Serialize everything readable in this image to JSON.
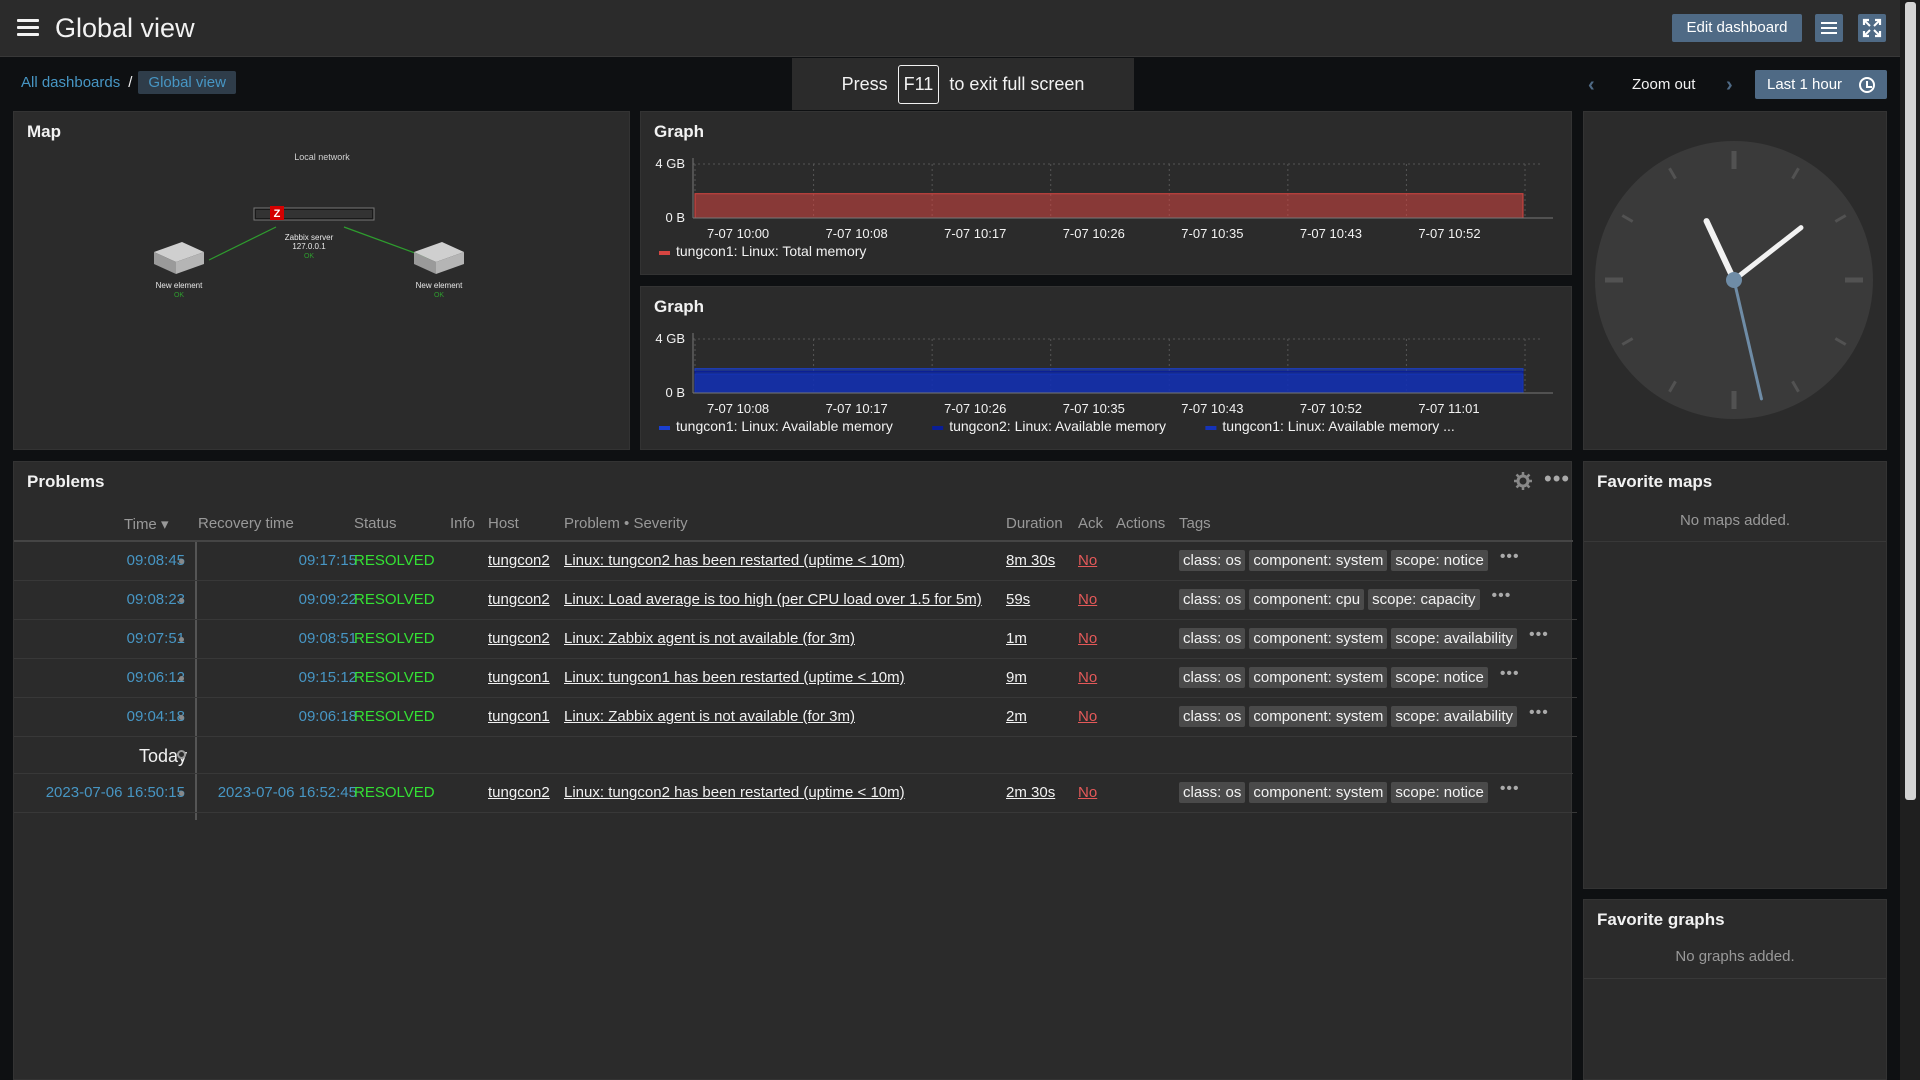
{
  "header": {
    "title": "Global view",
    "edit_label": "Edit dashboard"
  },
  "breadcrumb": {
    "all": "All dashboards",
    "separator": "/",
    "current": "Global view"
  },
  "fullscreen_banner": {
    "press": "Press",
    "key": "F11",
    "suffix": "to exit full screen"
  },
  "timebar": {
    "zoom_out": "Zoom out",
    "period": "Last 1 hour"
  },
  "map": {
    "title": "Map",
    "map_name": "Local network",
    "server_label": "Zabbix server",
    "server_ip": "127.0.0.1",
    "server_status": "OK",
    "left_label": "New element",
    "left_status": "OK",
    "right_label": "New element",
    "right_status": "OK"
  },
  "graph1": {
    "title": "Graph",
    "chart_data": {
      "type": "area",
      "y_ticks": [
        "4 GB",
        "0 B"
      ],
      "x_ticks": [
        "7-07 10:00",
        "7-07 10:08",
        "7-07 10:17",
        "7-07 10:26",
        "7-07 10:35",
        "7-07 10:43",
        "7-07 10:52"
      ],
      "series": [
        {
          "name": "tungcon1: Linux: Total memory",
          "color": "#d64541",
          "level": 0.45
        }
      ]
    }
  },
  "graph2": {
    "title": "Graph",
    "chart_data": {
      "type": "area",
      "y_ticks": [
        "4 GB",
        "0 B"
      ],
      "x_ticks": [
        "7-07 10:08",
        "7-07 10:17",
        "7-07 10:26",
        "7-07 10:35",
        "7-07 10:43",
        "7-07 10:52",
        "7-07 11:01"
      ],
      "series": [
        {
          "name": "tungcon1: Linux: Available memory",
          "color": "#1a3fd0",
          "level": 0.45
        },
        {
          "name": "tungcon2: Linux: Available memory",
          "color": "#0a1e96",
          "level": 0.4
        },
        {
          "name": "tungcon1: Linux: Available memory ...",
          "color": "#1533b8",
          "level": 0.35
        }
      ]
    }
  },
  "problems": {
    "title": "Problems",
    "columns": {
      "time": "Time ▾",
      "recovery": "Recovery time",
      "status": "Status",
      "info": "Info",
      "host": "Host",
      "problem": "Problem • Severity",
      "duration": "Duration",
      "ack": "Ack",
      "actions": "Actions",
      "tags": "Tags"
    },
    "rows": [
      {
        "time": "09:08:45",
        "recovery": "09:17:15",
        "status": "RESOLVED",
        "host": "tungcon2",
        "problem": "Linux: tungcon2 has been restarted (uptime < 10m)",
        "duration": "8m 30s",
        "ack": "No",
        "tags": [
          "class: os",
          "component: system",
          "scope: notice"
        ]
      },
      {
        "time": "09:08:23",
        "recovery": "09:09:22",
        "status": "RESOLVED",
        "host": "tungcon2",
        "problem": "Linux: Load average is too high (per CPU load over 1.5 for 5m)",
        "duration": "59s",
        "ack": "No",
        "tags": [
          "class: os",
          "component: cpu",
          "scope: capacity"
        ]
      },
      {
        "time": "09:07:51",
        "recovery": "09:08:51",
        "status": "RESOLVED",
        "host": "tungcon2",
        "problem": "Linux: Zabbix agent is not available (for 3m)",
        "duration": "1m",
        "ack": "No",
        "tags": [
          "class: os",
          "component: system",
          "scope: availability"
        ]
      },
      {
        "time": "09:06:12",
        "recovery": "09:15:12",
        "status": "RESOLVED",
        "host": "tungcon1",
        "problem": "Linux: tungcon1 has been restarted (uptime < 10m)",
        "duration": "9m",
        "ack": "No",
        "tags": [
          "class: os",
          "component: system",
          "scope: notice"
        ]
      },
      {
        "time": "09:04:18",
        "recovery": "09:06:18",
        "status": "RESOLVED",
        "host": "tungcon1",
        "problem": "Linux: Zabbix agent is not available (for 3m)",
        "duration": "2m",
        "ack": "No",
        "tags": [
          "class: os",
          "component: system",
          "scope: availability"
        ]
      }
    ],
    "today_label": "Today",
    "older_rows": [
      {
        "time": "2023-07-06 16:50:15",
        "recovery": "2023-07-06 16:52:45",
        "status": "RESOLVED",
        "host": "tungcon2",
        "problem": "Linux: tungcon2 has been restarted (uptime < 10m)",
        "duration": "2m 30s",
        "ack": "No",
        "tags": [
          "class: os",
          "component: system",
          "scope: notice"
        ]
      }
    ]
  },
  "favorite_maps": {
    "title": "Favorite maps",
    "empty": "No maps added."
  },
  "favorite_graphs": {
    "title": "Favorite graphs",
    "empty": "No graphs added."
  },
  "colors": {
    "accent": "#4f6a85",
    "link": "#4796c4",
    "resolved": "#34e134",
    "ack_no": "#e45959"
  }
}
